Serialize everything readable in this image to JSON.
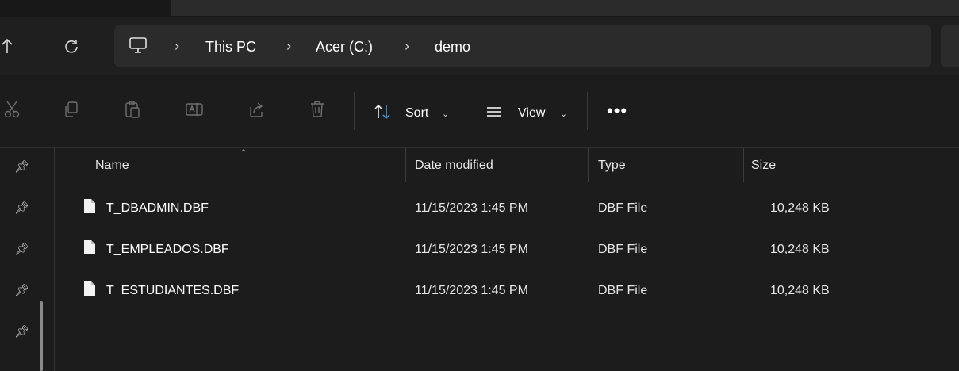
{
  "breadcrumb": {
    "items": [
      "This PC",
      "Acer (C:)",
      "demo"
    ],
    "separator": "›"
  },
  "nav": {
    "up_icon": "arrow-up-icon",
    "refresh_icon": "refresh-icon",
    "pc_icon": "monitor-icon"
  },
  "commandbar": {
    "sort_label": "Sort",
    "view_label": "View",
    "more_label": "•••",
    "icons": [
      "cut-icon",
      "copy-icon",
      "paste-icon",
      "rename-icon",
      "share-icon",
      "delete-icon"
    ]
  },
  "columns": {
    "name": "Name",
    "date": "Date modified",
    "type": "Type",
    "size": "Size"
  },
  "files": [
    {
      "name": "T_DBADMIN.DBF",
      "date": "11/15/2023 1:45 PM",
      "type": "DBF File",
      "size": "10,248 KB"
    },
    {
      "name": "T_EMPLEADOS.DBF",
      "date": "11/15/2023 1:45 PM",
      "type": "DBF File",
      "size": "10,248 KB"
    },
    {
      "name": "T_ESTUDIANTES.DBF",
      "date": "11/15/2023 1:45 PM",
      "type": "DBF File",
      "size": "10,248 KB"
    }
  ],
  "colors": {
    "background": "#1c1c1c",
    "address_bar": "#2b2b2b",
    "text": "#ffffff"
  }
}
